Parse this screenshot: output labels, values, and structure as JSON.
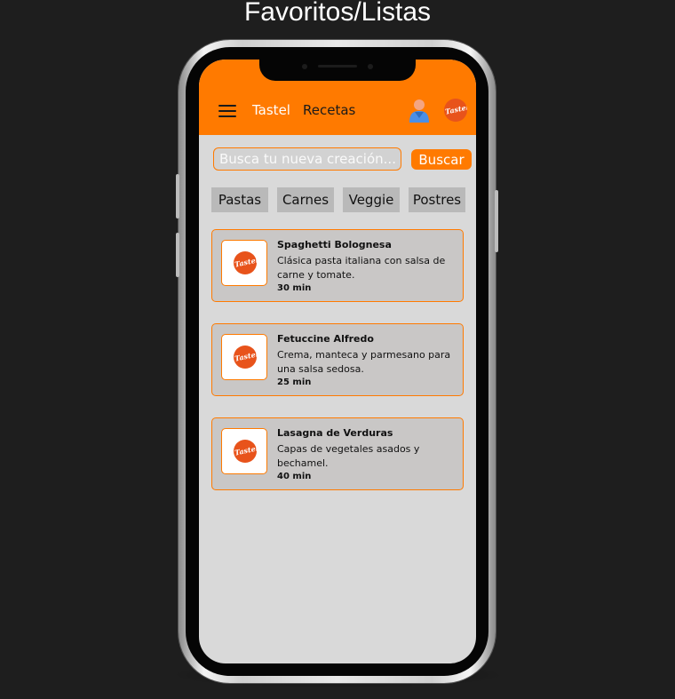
{
  "page_title": "Favoritos/Listas",
  "header": {
    "brand": "Tastel",
    "nav_recetas": "Recetas",
    "logo_text": "Tastel"
  },
  "search": {
    "placeholder": "Busca tu nueva creación...",
    "button_label": "Buscar"
  },
  "categories": [
    "Pastas",
    "Carnes",
    "Veggie",
    "Postres"
  ],
  "recipes": [
    {
      "title": "Spaghetti Bolognesa",
      "description": "Clásica pasta italiana con salsa de carne y tomate.",
      "time": "30 min"
    },
    {
      "title": "Fetuccine Alfredo",
      "description": "Crema, manteca y parmesano para una salsa sedosa.",
      "time": "25 min"
    },
    {
      "title": "Lasagna de Verduras",
      "description": "Capas de vegetales asados y bechamel.",
      "time": "40 min"
    }
  ],
  "colors": {
    "accent": "#ff7a00",
    "logo": "#e8531b",
    "background": "#1e1e1e",
    "screen": "#d9d9d9",
    "card": "#c9c7c6",
    "chip": "#b9b9b9"
  },
  "icons": {
    "menu": "hamburger-icon",
    "user": "user-icon",
    "logo": "tastel-logo"
  }
}
